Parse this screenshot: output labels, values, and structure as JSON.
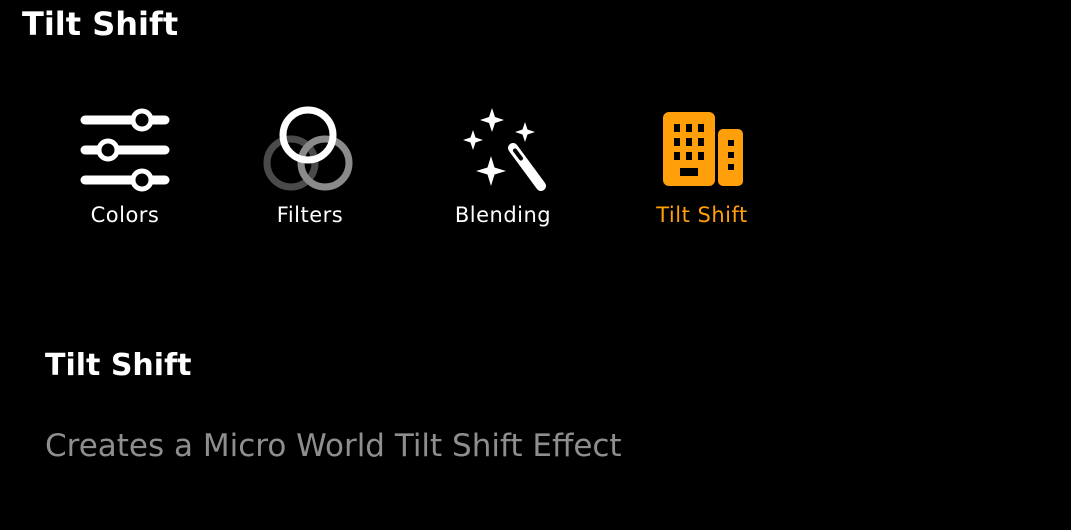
{
  "header": {
    "title": "Tilt Shift"
  },
  "tools": [
    {
      "id": "colors",
      "label": "Colors",
      "icon": "sliders-icon",
      "selected": false
    },
    {
      "id": "filters",
      "label": "Filters",
      "icon": "overlapping-circles-icon",
      "selected": false
    },
    {
      "id": "blending",
      "label": "Blending",
      "icon": "magic-wand-sparkles-icon",
      "selected": false
    },
    {
      "id": "tilt-shift",
      "label": "Tilt Shift",
      "icon": "buildings-icon",
      "selected": true
    }
  ],
  "detail": {
    "title": "Tilt Shift",
    "description": "Creates a Micro World Tilt Shift Effect"
  },
  "colors": {
    "background": "#000000",
    "text": "#ffffff",
    "accent": "#ff9f0a",
    "muted": "#8e8e8e",
    "icon_gray": "#6e6e6e"
  }
}
